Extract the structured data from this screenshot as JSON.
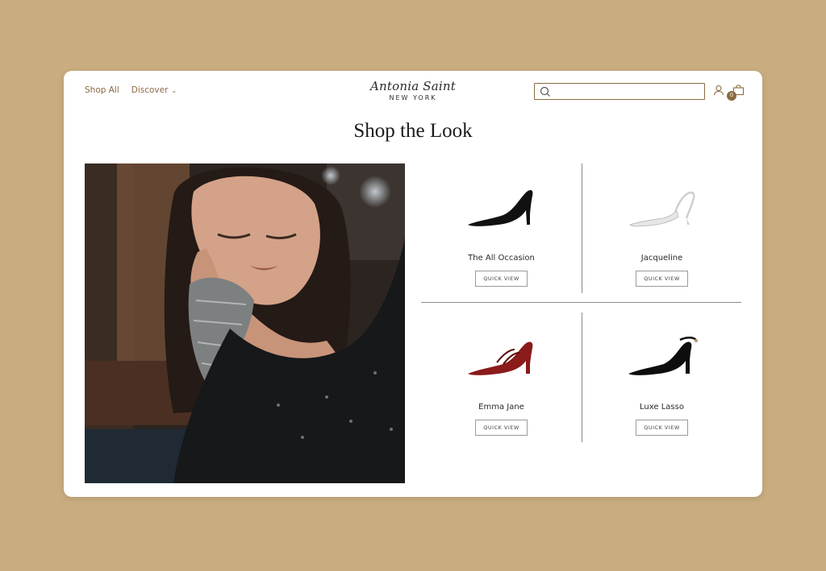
{
  "nav": {
    "shop_all": "Shop All",
    "discover": "Discover"
  },
  "logo": {
    "script": "Antonia Saint",
    "sub": "NEW YORK"
  },
  "search": {
    "placeholder": ""
  },
  "cart": {
    "count": "0"
  },
  "page": {
    "title": "Shop the Look"
  },
  "products": [
    {
      "name": "The All Occasion",
      "button": "QUICK VIEW",
      "color": "#111111"
    },
    {
      "name": "Jacqueline",
      "button": "QUICK VIEW",
      "color": "#e6e6e6"
    },
    {
      "name": "Emma Jane",
      "button": "QUICK VIEW",
      "color": "#8b1a1a"
    },
    {
      "name": "Luxe Lasso",
      "button": "QUICK VIEW",
      "color": "#0d0d0d"
    }
  ],
  "colors": {
    "background": "#c9ad80",
    "accent": "#8a6a43"
  }
}
